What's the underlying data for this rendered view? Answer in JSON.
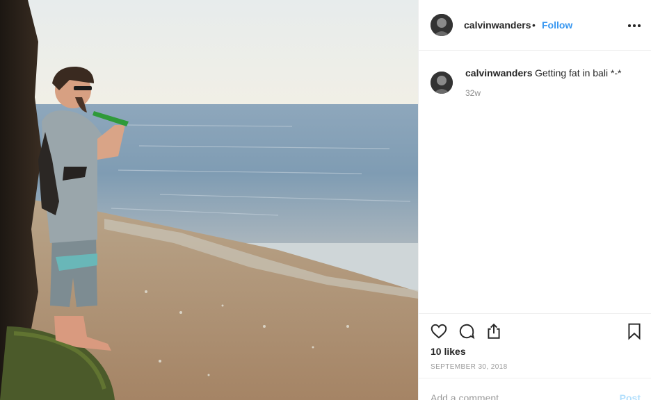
{
  "post": {
    "photo_alt": "Man drinking from a green bottle on a beach by a rock",
    "header": {
      "username": "calvinwanders",
      "separator": "•",
      "follow_label": "Follow",
      "more_icon": "more-options-icon"
    },
    "caption": {
      "username": "calvinwanders",
      "text": "Getting fat in bali *-*",
      "time": "32w"
    },
    "actions": {
      "like_icon": "heart-icon",
      "comment_icon": "comment-icon",
      "share_icon": "share-icon",
      "save_icon": "bookmark-icon"
    },
    "likes": "10 likes",
    "date": "September 30, 2018",
    "add_comment": {
      "placeholder": "Add a comment…",
      "post_label": "Post"
    }
  },
  "colors": {
    "link_blue": "#3897f0",
    "post_disabled": "#b2dffc",
    "text": "#262626",
    "muted": "#8e8e8e",
    "border": "#efefef"
  }
}
